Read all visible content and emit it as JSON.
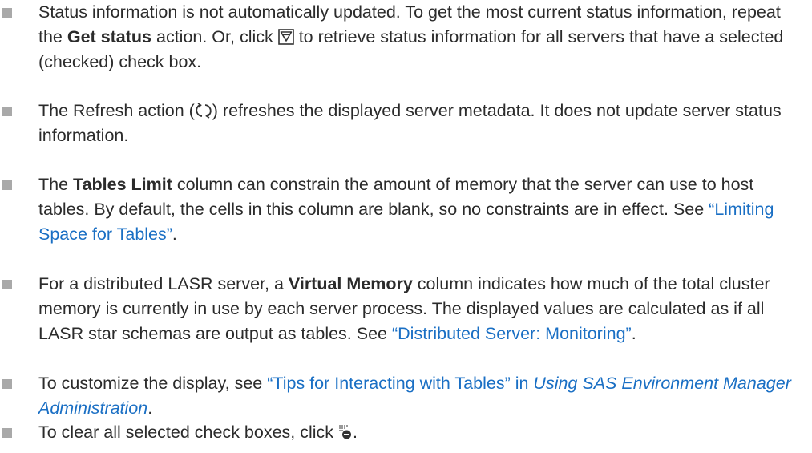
{
  "bullets": [
    {
      "seg1": "Status information is not automatically updated. To get the most current status information, repeat the ",
      "bold1": "Get status",
      "seg2": " action. Or, click ",
      "icon": "get-status-filter-icon",
      "seg3": " to retrieve status information for all servers that have a selected (checked) check box."
    },
    {
      "seg1": "The Refresh action (",
      "icon": "refresh-icon",
      "seg2": ") refreshes the displayed server metadata. It does not update server status information."
    },
    {
      "seg1": "The ",
      "bold1": "Tables Limit",
      "seg2": " column can constrain the amount of memory that the server can use to host tables. By default, the cells in this column are blank, so no constraints are in effect. See ",
      "link1": "“Limiting Space for Tables”",
      "seg3": "."
    },
    {
      "seg1": "For a distributed LASR server, a ",
      "bold1": "Virtual Memory",
      "seg2": " column indicates how much of the total cluster memory is currently in use by each server process. The displayed values are calculated as if all LASR star schemas are output as tables. See ",
      "link1": "“Distributed Server: Monitoring”",
      "seg3": "."
    },
    {
      "seg1": "To customize the display, see ",
      "link1": "“Tips for Interacting with Tables” in ",
      "link1_italic": "Using SAS Environment Manager Administration",
      "seg2": "."
    },
    {
      "seg1": "To clear all selected check boxes, click ",
      "icon": "clear-selections-icon",
      "seg2": "."
    }
  ],
  "colors": {
    "text": "#2b2b2b",
    "link": "#1a6fc4",
    "bullet": "#a9a9a9"
  }
}
